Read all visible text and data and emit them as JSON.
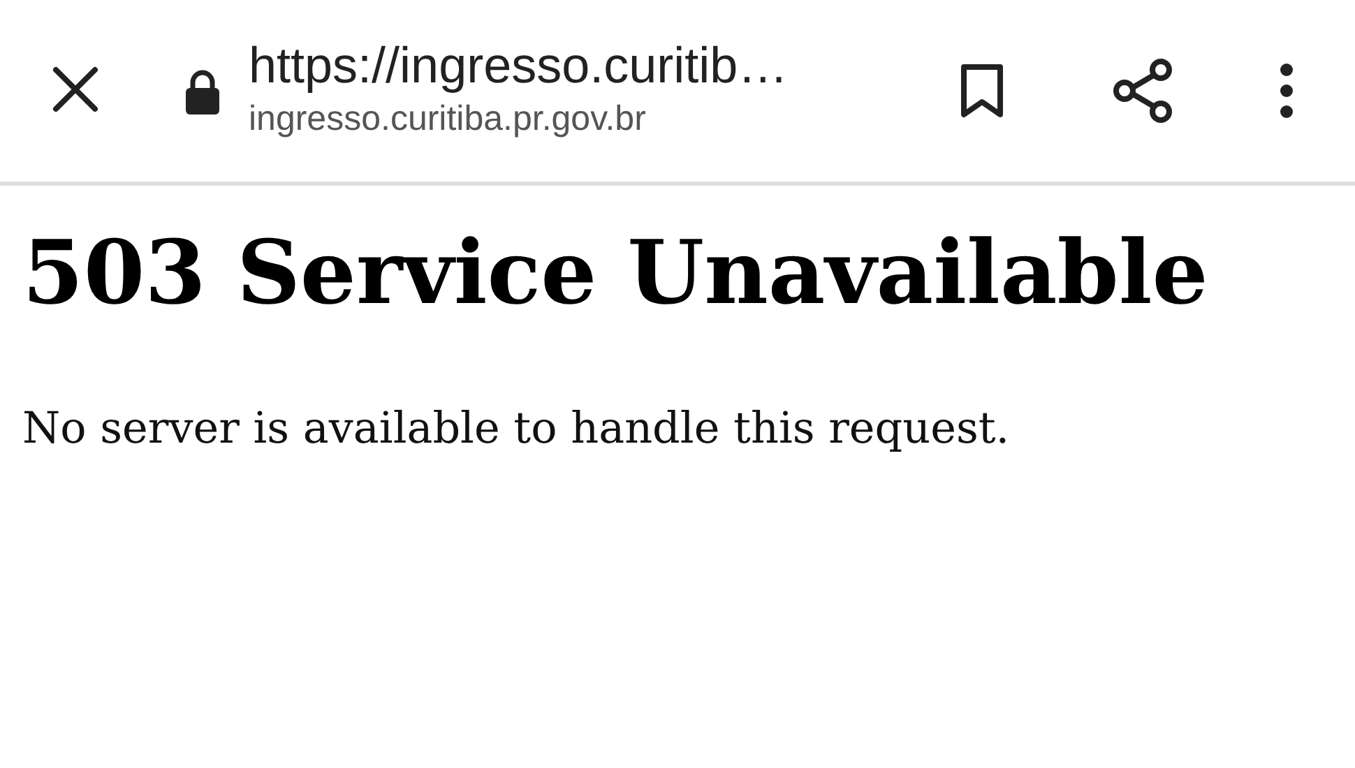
{
  "toolbar": {
    "url_title": "https://ingresso.curitib…",
    "domain": "ingresso.curitiba.pr.gov.br",
    "secure": true
  },
  "page": {
    "heading": "503 Service Unavailable",
    "message": "No server is available to handle this request."
  }
}
